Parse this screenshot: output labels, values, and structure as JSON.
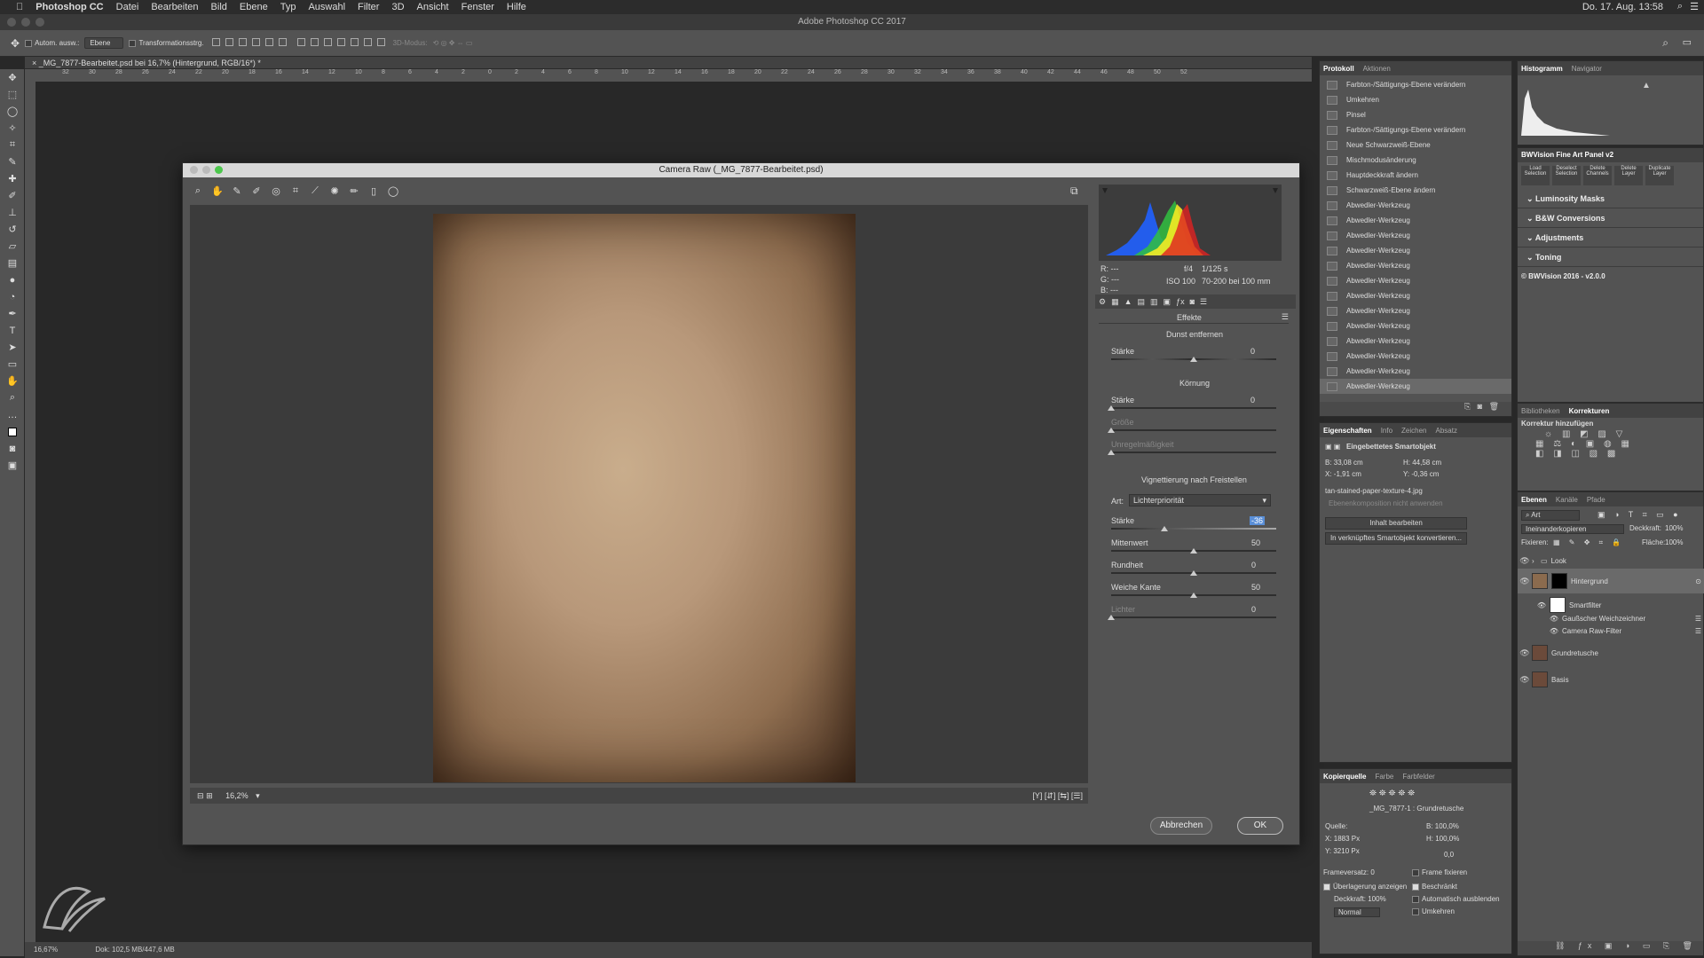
{
  "menubar": {
    "apple": "",
    "items": [
      "Photoshop CC",
      "Datei",
      "Bearbeiten",
      "Bild",
      "Ebene",
      "Typ",
      "Auswahl",
      "Filter",
      "3D",
      "Ansicht",
      "Fenster",
      "Hilfe"
    ],
    "clock": "Do. 17. Aug. 13:58"
  },
  "window_title": "Adobe Photoshop CC 2017",
  "options": {
    "auto_select": "Autom. ausw.:",
    "auto_select_value": "Ebene",
    "transform": "Transformationsstrg.",
    "mode3d": "3D-Modus:"
  },
  "document": {
    "tab": "_MG_7877-Bearbeitet.psd bei 16,7% (Hintergrund, RGB/16*) *",
    "ruler": [
      "32",
      "30",
      "28",
      "26",
      "24",
      "22",
      "20",
      "18",
      "16",
      "14",
      "12",
      "10",
      "8",
      "6",
      "4",
      "2",
      "0",
      "2",
      "4",
      "6",
      "8",
      "10",
      "12",
      "14",
      "16",
      "18",
      "20",
      "22",
      "24",
      "26",
      "28",
      "30",
      "32",
      "34",
      "36",
      "38",
      "40",
      "42",
      "44",
      "46",
      "48",
      "50",
      "52"
    ],
    "zoom": "16,67%",
    "status": "Dok: 102,5 MB/447,6 MB"
  },
  "camera_raw": {
    "title": "Camera Raw (_MG_7877-Bearbeitet.psd)",
    "zoom": "16,2%",
    "rgb": {
      "r": "R:   ---",
      "g": "G:   ---",
      "b": "B:   ---"
    },
    "exif": {
      "aperture": "f/4",
      "shutter": "1/125 s",
      "iso": "ISO 100",
      "lens": "70-200 bei 100 mm"
    },
    "panel_title": "Effekte",
    "dehaze": {
      "title": "Dunst entfernen",
      "amount_label": "Stärke",
      "amount": "0",
      "amount_level": 0.5
    },
    "grain": {
      "title": "Körnung",
      "amount_label": "Stärke",
      "amount": "0",
      "amount_level": 0,
      "size_label": "Größe",
      "size_level": 0,
      "roughness_label": "Unregelmäßigkeit",
      "roughness_level": 0
    },
    "vignette": {
      "title": "Vignettierung nach Freistellen",
      "style_label": "Art:",
      "style_value": "Lichterpriorität",
      "amount_label": "Stärke",
      "amount": "-36",
      "amount_level": 0.32,
      "midpoint_label": "Mittenwert",
      "midpoint": "50",
      "midpoint_level": 0.5,
      "roundness_label": "Rundheit",
      "roundness": "0",
      "roundness_level": 0.5,
      "feather_label": "Weiche Kante",
      "feather": "50",
      "feather_level": 0.5,
      "highlights_label": "Lichter",
      "highlights": "0",
      "highlights_level": 0
    },
    "cancel": "Abbrechen",
    "ok": "OK"
  },
  "history": {
    "tabs": [
      "Protokoll",
      "Aktionen"
    ],
    "items": [
      "Farbton-/Sättigungs-Ebene verändern",
      "Umkehren",
      "Pinsel",
      "Farbton-/Sättigungs-Ebene verändern",
      "Neue Schwarzweiß-Ebene",
      "Mischmodusänderung",
      "Hauptdeckkraft ändern",
      "Schwarzweiß-Ebene ändern",
      "Abwedler-Werkzeug",
      "Abwedler-Werkzeug",
      "Abwedler-Werkzeug",
      "Abwedler-Werkzeug",
      "Abwedler-Werkzeug",
      "Abwedler-Werkzeug",
      "Abwedler-Werkzeug",
      "Abwedler-Werkzeug",
      "Abwedler-Werkzeug",
      "Abwedler-Werkzeug",
      "Abwedler-Werkzeug",
      "Abwedler-Werkzeug",
      "Abwedler-Werkzeug"
    ]
  },
  "properties": {
    "tabs": [
      "Eigenschaften",
      "Info",
      "Zeichen",
      "Absatz"
    ],
    "title": "Eingebettetes Smartobjekt",
    "w": "B: 33,08 cm",
    "h": "H: 44,58 cm",
    "x": "X:  -1,91 cm",
    "y": "Y:  -0,36 cm",
    "file": "tan-stained-paper-texture-4.jpg",
    "comp": "Ebenenkomposition nicht anwenden",
    "edit": "Inhalt bearbeiten",
    "convert": "In verknüpftes Smartobjekt konvertieren..."
  },
  "clone": {
    "tabs": [
      "Kopierquelle",
      "Farbe",
      "Farbfelder"
    ],
    "source_name": "_MG_7877-1 : Grundretusche",
    "source_label": "Quelle:",
    "x": "X:  1883 Px",
    "y": "Y:  3210 Px",
    "w": "B:  100,0%",
    "h": "H:  100,0%",
    "angle": "0,0",
    "frame_offset": "Frameversatz:  0",
    "lock_frame": "Frame fixieren",
    "show_overlay": "Überlagerung anzeigen",
    "opacity": "Deckkraft:  100%",
    "mode": "Normal",
    "clipped": "Beschränkt",
    "auto_hide": "Automatisch ausblenden",
    "invert": "Umkehren"
  },
  "histogram_panel": {
    "tabs": [
      "Histogramm",
      "Navigator"
    ]
  },
  "bwvision": {
    "title": "BWVision Fine Art Panel v2",
    "buttons": [
      "Load Selection",
      "Deselect Selection",
      "Delete Channels",
      "Delete Layer",
      "Duplicate Layer"
    ],
    "sections": [
      "Luminosity Masks",
      "B&W Conversions",
      "Adjustments",
      "Toning"
    ],
    "footer": "© BWVision 2016 - v2.0.0"
  },
  "adjustments": {
    "tabs": [
      "Bibliotheken",
      "Korrekturen"
    ],
    "title": "Korrektur hinzufügen"
  },
  "layers": {
    "tabs": [
      "Ebenen",
      "Kanäle",
      "Pfade"
    ],
    "filter": "Art",
    "blend": "Ineinanderkopieren",
    "opacity_label": "Deckkraft:",
    "opacity": "100%",
    "lock_label": "Fixieren:",
    "fill_label": "Fläche:",
    "fill": "100%",
    "items": [
      {
        "name": "Look"
      },
      {
        "name": "Hintergrund"
      },
      {
        "name": "Smartfilter"
      },
      {
        "name": "Gaußscher Weichzeichner"
      },
      {
        "name": "Camera Raw-Filter"
      },
      {
        "name": "Grundretusche"
      },
      {
        "name": "Basis"
      }
    ]
  }
}
